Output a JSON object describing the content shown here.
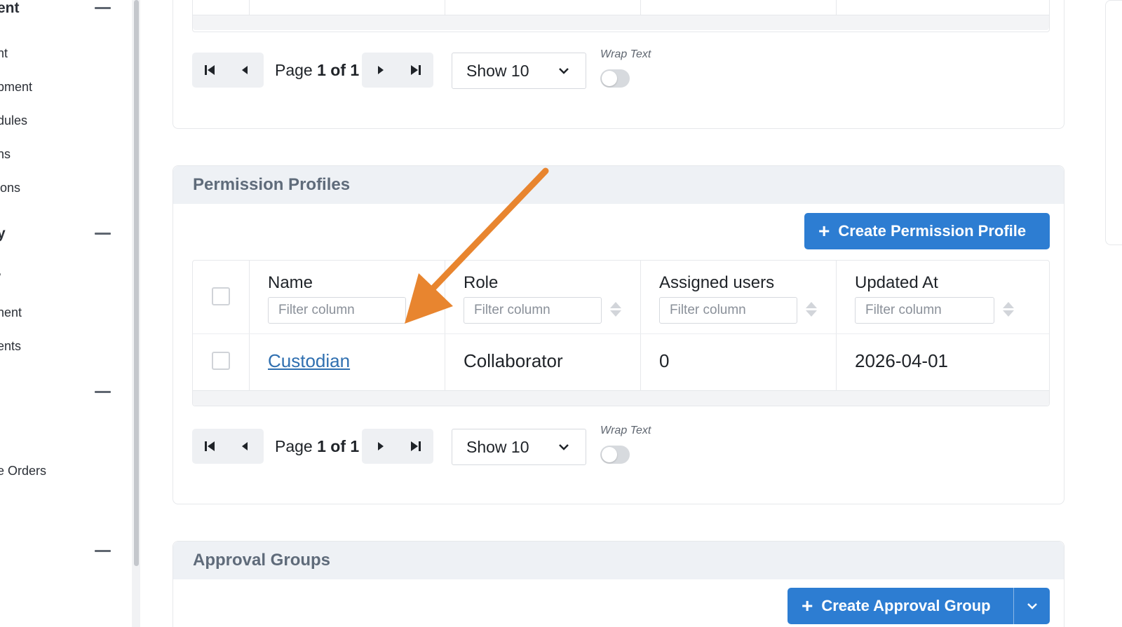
{
  "sidebar": {
    "groups": [
      {
        "heading": "ent",
        "items": [
          "nt",
          "pment",
          "dules",
          "ns",
          "ions"
        ]
      },
      {
        "heading": "y",
        "items": [
          "/",
          "nent",
          "ents"
        ]
      },
      {
        "heading": "",
        "items": [
          "e Orders"
        ]
      },
      {
        "heading": "",
        "items": []
      }
    ]
  },
  "top_pager": {
    "page_label": "Page",
    "page_value": "1 of 1",
    "show_value": "Show 10",
    "wrap_label": "Wrap Text"
  },
  "permission_profiles": {
    "title": "Permission Profiles",
    "create_label": "Create Permission Profile",
    "columns": [
      "Name",
      "Role",
      "Assigned users",
      "Updated At"
    ],
    "filter_placeholder": "Filter column",
    "rows": [
      {
        "name": "Custodian",
        "role": "Collaborator",
        "assigned_users": "0",
        "updated_at": "2026-04-01"
      }
    ],
    "pager": {
      "page_label": "Page",
      "page_value": "1 of 1",
      "show_value": "Show 10",
      "wrap_label": "Wrap Text"
    }
  },
  "approval_groups": {
    "title": "Approval Groups",
    "create_label": "Create Approval Group"
  },
  "colors": {
    "primary": "#2d7dd2",
    "link": "#2f6fb0",
    "annotation_arrow": "#e8852f",
    "card_header_bg": "#eef1f5"
  },
  "icons": [
    "first-page-icon",
    "previous-page-icon",
    "next-page-icon",
    "last-page-icon",
    "chevron-down-icon",
    "plus-icon",
    "sort-icon",
    "annotation-arrow"
  ]
}
